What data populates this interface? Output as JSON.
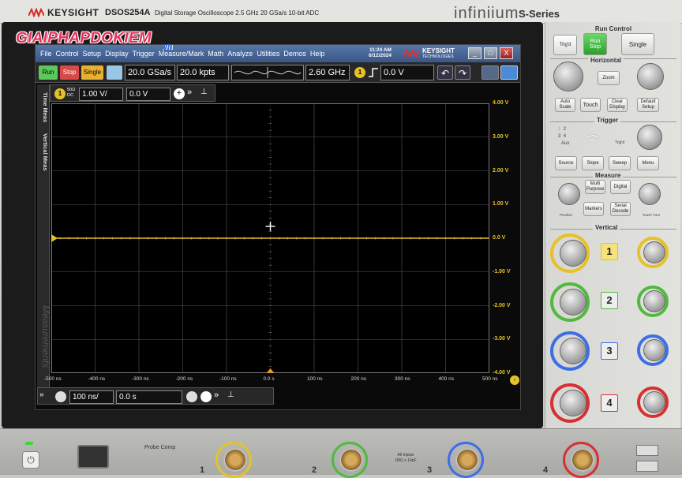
{
  "header": {
    "brand": "KEYSIGHT",
    "model": "DSOS254A",
    "description": "Digital Storage Oscilloscope  2.5 GHz  20 GSa/s  10-bit ADC",
    "product_line": "infiniium",
    "series": "S-Series"
  },
  "watermark": {
    "text": "GIAIPHAPDOKIEM",
    "sub": ".VN"
  },
  "menubar": {
    "items": [
      "File",
      "Control",
      "Setup",
      "Display",
      "Trigger",
      "Measure/Mark",
      "Math",
      "Analyze",
      "Utilities",
      "Demos",
      "Help"
    ],
    "time": "11:24 AM",
    "date": "6/12/2024",
    "logo": "KEYSIGHT",
    "logo_sub": "TECHNOLOGIES",
    "minimize": "_",
    "restore": "□",
    "close": "X"
  },
  "toolbar": {
    "run": "Run",
    "stop": "Stop",
    "single": "Single",
    "sample_rate": "20.0 GSa/s",
    "memory_depth": "20.0 kpts",
    "bandwidth": "2.60 GHz",
    "trigger_channel": "1",
    "trigger_level": "0.0 V"
  },
  "side_tabs": [
    "Time Meas",
    "Vertical Meas"
  ],
  "measurements_label": "Measurements",
  "channel_bar": {
    "channel": "1",
    "impedance": "50Ω",
    "coupling": "DC",
    "scale": "1.00 V/",
    "offset": "0.0 V"
  },
  "timebase_bar": {
    "scale": "100 ns/",
    "position": "0.0 s"
  },
  "chart_data": {
    "type": "line",
    "title": "",
    "xlabel": "",
    "ylabel": "",
    "x_ticks": [
      "-500 ns",
      "-400 ns",
      "-300 ns",
      "-200 ns",
      "-100 ns",
      "0.0 s",
      "100 ns",
      "200 ns",
      "300 ns",
      "400 ns",
      "500 ns"
    ],
    "y_ticks": [
      "4.00 V",
      "3.00 V",
      "2.00 V",
      "1.00 V",
      "0.0 V",
      "-1.00 V",
      "-2.00 V",
      "-3.00 V",
      "-4.00 V"
    ],
    "xlim": [
      -500,
      500
    ],
    "ylim": [
      -4,
      4
    ],
    "grid": true,
    "series": [
      {
        "color": "#e6c228",
        "x": [
          -500,
          -400,
          -300,
          -200,
          -100,
          0,
          100,
          200,
          300,
          400,
          500
        ],
        "values": [
          0,
          0,
          0,
          0,
          0,
          0,
          0,
          0,
          0,
          0,
          0
        ]
      }
    ]
  },
  "panel": {
    "run_control": "Run Control",
    "run_stop": "Run Stop",
    "single": "Single",
    "trigd_small": "Trig'd",
    "horizontal": "Horizontal",
    "zoom": "Zoom",
    "auto_scale": "Auto Scale",
    "touch": "Touch",
    "clear_display": "Clear Display",
    "default_setup": "Default Setup",
    "trigger": "Trigger",
    "aux": "Aux",
    "trigd": "Trig'd",
    "source": "Source",
    "slope": "Slope",
    "sweep": "Sweep",
    "menu": "Menu",
    "measure": "Measure",
    "multi_purpose": "Multi Purpose",
    "digital": "Digital",
    "markers": "Markers",
    "serial_decode": "Serial Decode",
    "position": "Position",
    "touch_turn": "Touch Turn",
    "vertical": "Vertical",
    "channels": [
      "1",
      "2",
      "3",
      "4"
    ],
    "channel_colors": [
      "#e6c228",
      "#4fba3e",
      "#3e6ee6",
      "#d83030"
    ]
  },
  "front": {
    "probe_comp": "Probe Comp",
    "all_inputs": "All Inputs",
    "inputs_spec": "1MΩ ≤ 14pF",
    "inputs": [
      "1",
      "2",
      "3",
      "4"
    ]
  }
}
